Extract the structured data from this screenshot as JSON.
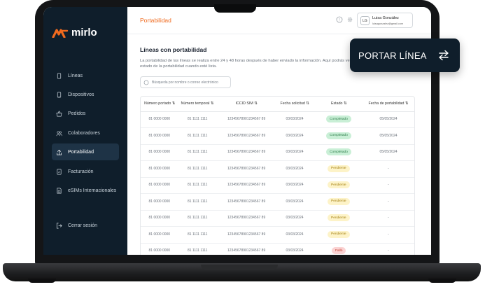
{
  "app": {
    "brand": "mirlo",
    "brand_color": "#f06a1e",
    "sidebar_color": "#0f1e2b"
  },
  "sidebar": {
    "items": [
      {
        "label": "Líneas",
        "icon": "phone-icon"
      },
      {
        "label": "Dispositivos",
        "icon": "device-icon"
      },
      {
        "label": "Pedidos",
        "icon": "basket-icon"
      },
      {
        "label": "Colaboradores",
        "icon": "users-icon"
      },
      {
        "label": "Portabilidad",
        "icon": "share-icon",
        "active": true
      },
      {
        "label": "Facturación",
        "icon": "invoice-icon"
      },
      {
        "label": "eSIMs Internacionales",
        "icon": "sim-icon"
      }
    ],
    "logout": {
      "label": "Cerrar sesión",
      "icon": "logout-icon"
    }
  },
  "header": {
    "title": "Portabilidad",
    "user": {
      "initials": "LG",
      "name": "Luisa González",
      "email": "luisagonzalez@gmail.com"
    }
  },
  "main": {
    "section_title": "Líneas con portabilidad",
    "description": "La portabilidad de las líneas se realiza entre 24 y 48 horas después de haber enviado la información. Aquí podrás ver el estado de la portabilidad cuando esté lista.",
    "search": {
      "placeholder": "Búsqueda por nombre o correo electrónico",
      "value": ""
    },
    "table": {
      "columns": [
        "Número portado ⇅",
        "Número temporal ⇅",
        "ICCID SIM ⇅",
        "Fecha solicitud ⇅",
        "Estado ⇅",
        "Fecha de portabilidad ⇅"
      ],
      "rows": [
        {
          "portado": "81 0000 0000",
          "temporal": "81 1111 1111",
          "iccid": "12345678901234567 89",
          "solicitud": "03/03/2024",
          "estado": "Completado",
          "tone": "green",
          "portabilidad": "05/05/2024"
        },
        {
          "portado": "81 0000 0000",
          "temporal": "81 1111 1111",
          "iccid": "12345678901234567 89",
          "solicitud": "03/03/2024",
          "estado": "Completado",
          "tone": "green",
          "portabilidad": "05/05/2024"
        },
        {
          "portado": "81 0000 0000",
          "temporal": "81 1111 1111",
          "iccid": "12345678901234567 89",
          "solicitud": "03/03/2024",
          "estado": "Completado",
          "tone": "green",
          "portabilidad": "05/05/2024"
        },
        {
          "portado": "81 0000 0000",
          "temporal": "81 1111 1111",
          "iccid": "12345678901234567 89",
          "solicitud": "03/03/2024",
          "estado": "Pendiente",
          "tone": "yellow",
          "portabilidad": "-"
        },
        {
          "portado": "81 0000 0000",
          "temporal": "81 1111 1111",
          "iccid": "12345678901234567 89",
          "solicitud": "03/03/2024",
          "estado": "Pendiente",
          "tone": "yellow",
          "portabilidad": "-"
        },
        {
          "portado": "81 0000 0000",
          "temporal": "81 1111 1111",
          "iccid": "12345678901234567 89",
          "solicitud": "03/03/2024",
          "estado": "Pendiente",
          "tone": "yellow",
          "portabilidad": "-"
        },
        {
          "portado": "81 0000 0000",
          "temporal": "81 1111 1111",
          "iccid": "12345678901234567 89",
          "solicitud": "03/03/2024",
          "estado": "Pendiente",
          "tone": "yellow",
          "portabilidad": "-"
        },
        {
          "portado": "81 0000 0000",
          "temporal": "81 1111 1111",
          "iccid": "12345678901234567 89",
          "solicitud": "03/03/2024",
          "estado": "Pendiente",
          "tone": "yellow",
          "portabilidad": "-"
        },
        {
          "portado": "81 0000 0000",
          "temporal": "81 1111 1111",
          "iccid": "12345678901234567 89",
          "solicitud": "03/03/2024",
          "estado": "Falló",
          "tone": "red",
          "portabilidad": "-"
        }
      ]
    }
  },
  "cta": {
    "label": "PORTAR LÍNEA",
    "icon": "swap-arrows-icon"
  }
}
